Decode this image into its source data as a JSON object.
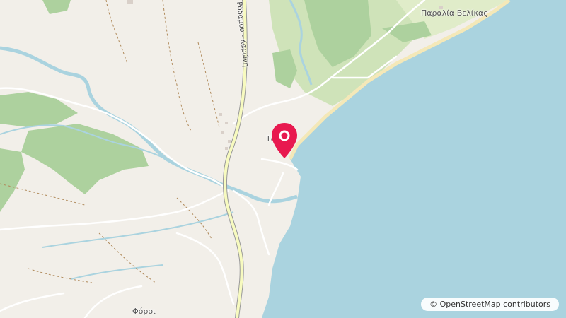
{
  "map": {
    "places": [
      {
        "name": "Παραλία Βελίκας"
      },
      {
        "name": "Τζάνες"
      },
      {
        "name": "Φόροι"
      }
    ],
    "road_name": "Ρόδαμου - Καρώνη",
    "attribution": "© OpenStreetMap contributors",
    "marker_icon": "map-pin-icon",
    "colors": {
      "land": "#f2efe9",
      "sea": "#aad3df",
      "forest": "#add19e",
      "farmland": "#c8dcb0",
      "river": "#aad3df",
      "main_road": "#f7fabf",
      "marker": "#e8194f"
    }
  }
}
